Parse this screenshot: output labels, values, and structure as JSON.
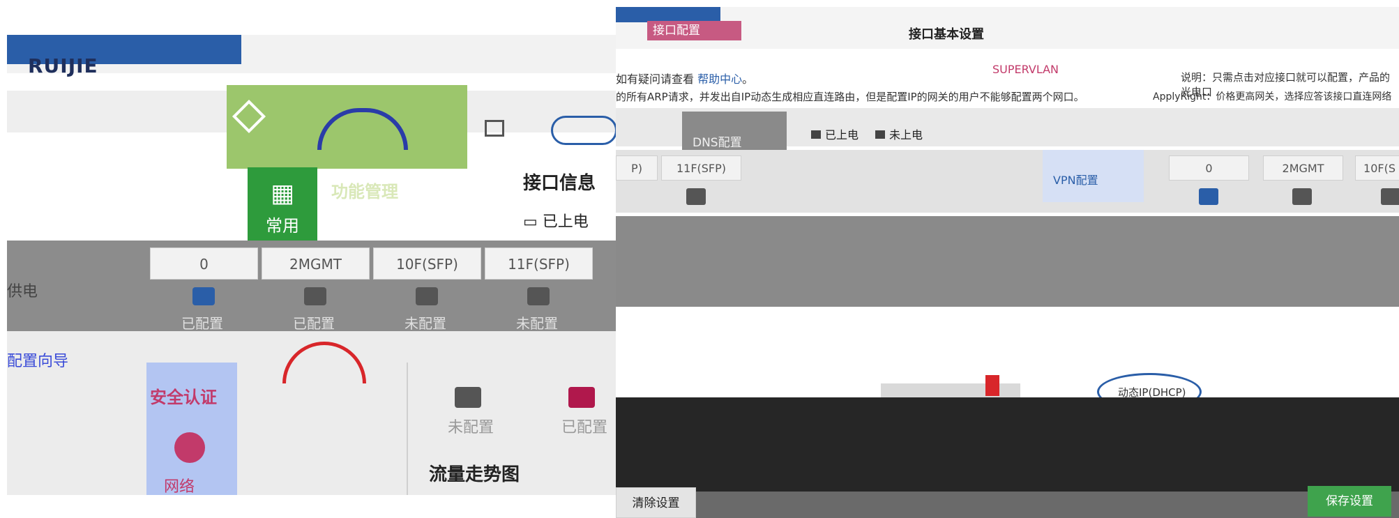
{
  "left": {
    "brand": "RUIJIE",
    "nav": {
      "common_label": "常用",
      "func_title": "功能管理"
    },
    "port_info": {
      "title": "接口信息",
      "legend_on": "已上电"
    },
    "ports": [
      {
        "name": "0",
        "status": "已配置",
        "color": "#2a5ea8"
      },
      {
        "name": "2MGMT",
        "status": "已配置",
        "color": "#555555"
      },
      {
        "name": "10F(SFP)",
        "status": "未配置",
        "color": "#555555"
      },
      {
        "name": "11F(SFP)",
        "status": "未配置",
        "color": "#555555"
      }
    ],
    "side_labels": {
      "power": "供电",
      "config_guide": "配置向导"
    },
    "sidebar": {
      "security": "安全认证",
      "network": "网络"
    },
    "legend": {
      "unconfigured": "未配置",
      "configured": "已配置"
    },
    "trend_title": "流量走势图"
  },
  "right": {
    "tab_label": "接口配置",
    "title": "接口基本设置",
    "help_prefix": "如有疑问请查看",
    "help_link": "帮助中心",
    "help_suffix": "。",
    "warning": "的所有ARP请求，并发出自IP动态生成相应直连路由，但是配置IP的网关的用户不能够配置两个网口。",
    "superv": "SUPERVLAN",
    "note": "说明：只需点击对应接口就可以配置，产品的光电口",
    "note2": "ApplyRight：价格更高网关，选择应答该接口直连网络",
    "dns_tab": "DNS配置",
    "legend_on": "已上电",
    "legend_off": "未上电",
    "vpn_tab": "VPN配置",
    "ports": [
      {
        "name": "P)",
        "color": "#555555"
      },
      {
        "name": "11F(SFP)",
        "color": "#555555"
      },
      {
        "name": "0",
        "color": "#2a5ea8"
      },
      {
        "name": "2MGMT",
        "color": "#555555"
      },
      {
        "name": "10F(S",
        "color": "#555555"
      }
    ],
    "dhcp_label": "动态IP(DHCP)",
    "clear_button": "清除设置",
    "save_button": "保存设置"
  },
  "colors": {
    "accent_green": "#3fa34d",
    "accent_blue": "#2a5ea8",
    "accent_pink": "#c23a6a"
  }
}
